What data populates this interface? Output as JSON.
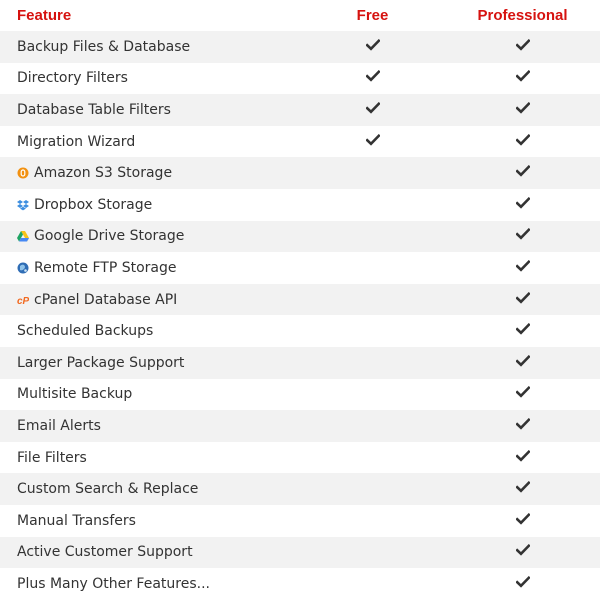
{
  "header": {
    "feature": "Feature",
    "free": "Free",
    "professional": "Professional"
  },
  "colors": {
    "header_red": "#d6120f",
    "row_stripe": "#f2f2f2",
    "text": "#333333",
    "check": "#333333"
  },
  "rows": [
    {
      "feature": "Backup Files & Database",
      "icon": null,
      "free": true,
      "pro": true
    },
    {
      "feature": "Directory Filters",
      "icon": null,
      "free": true,
      "pro": true
    },
    {
      "feature": "Database Table Filters",
      "icon": null,
      "free": true,
      "pro": true
    },
    {
      "feature": "Migration Wizard",
      "icon": null,
      "free": true,
      "pro": true
    },
    {
      "feature": "Amazon S3 Storage",
      "icon": "amazon-s3-icon",
      "free": false,
      "pro": true
    },
    {
      "feature": "Dropbox Storage",
      "icon": "dropbox-icon",
      "free": false,
      "pro": true
    },
    {
      "feature": "Google Drive Storage",
      "icon": "google-drive-icon",
      "free": false,
      "pro": true
    },
    {
      "feature": "Remote FTP Storage",
      "icon": "ftp-globe-icon",
      "free": false,
      "pro": true
    },
    {
      "feature": "cPanel Database API",
      "icon": "cpanel-icon",
      "free": false,
      "pro": true
    },
    {
      "feature": "Scheduled Backups",
      "icon": null,
      "free": false,
      "pro": true
    },
    {
      "feature": "Larger Package Support",
      "icon": null,
      "free": false,
      "pro": true
    },
    {
      "feature": "Multisite Backup",
      "icon": null,
      "free": false,
      "pro": true
    },
    {
      "feature": "Email Alerts",
      "icon": null,
      "free": false,
      "pro": true
    },
    {
      "feature": "File Filters",
      "icon": null,
      "free": false,
      "pro": true
    },
    {
      "feature": "Custom Search & Replace",
      "icon": null,
      "free": false,
      "pro": true
    },
    {
      "feature": "Manual Transfers",
      "icon": null,
      "free": false,
      "pro": true
    },
    {
      "feature": "Active Customer Support",
      "icon": null,
      "free": false,
      "pro": true
    },
    {
      "feature": "Plus Many Other Features...",
      "icon": null,
      "free": false,
      "pro": true
    }
  ]
}
